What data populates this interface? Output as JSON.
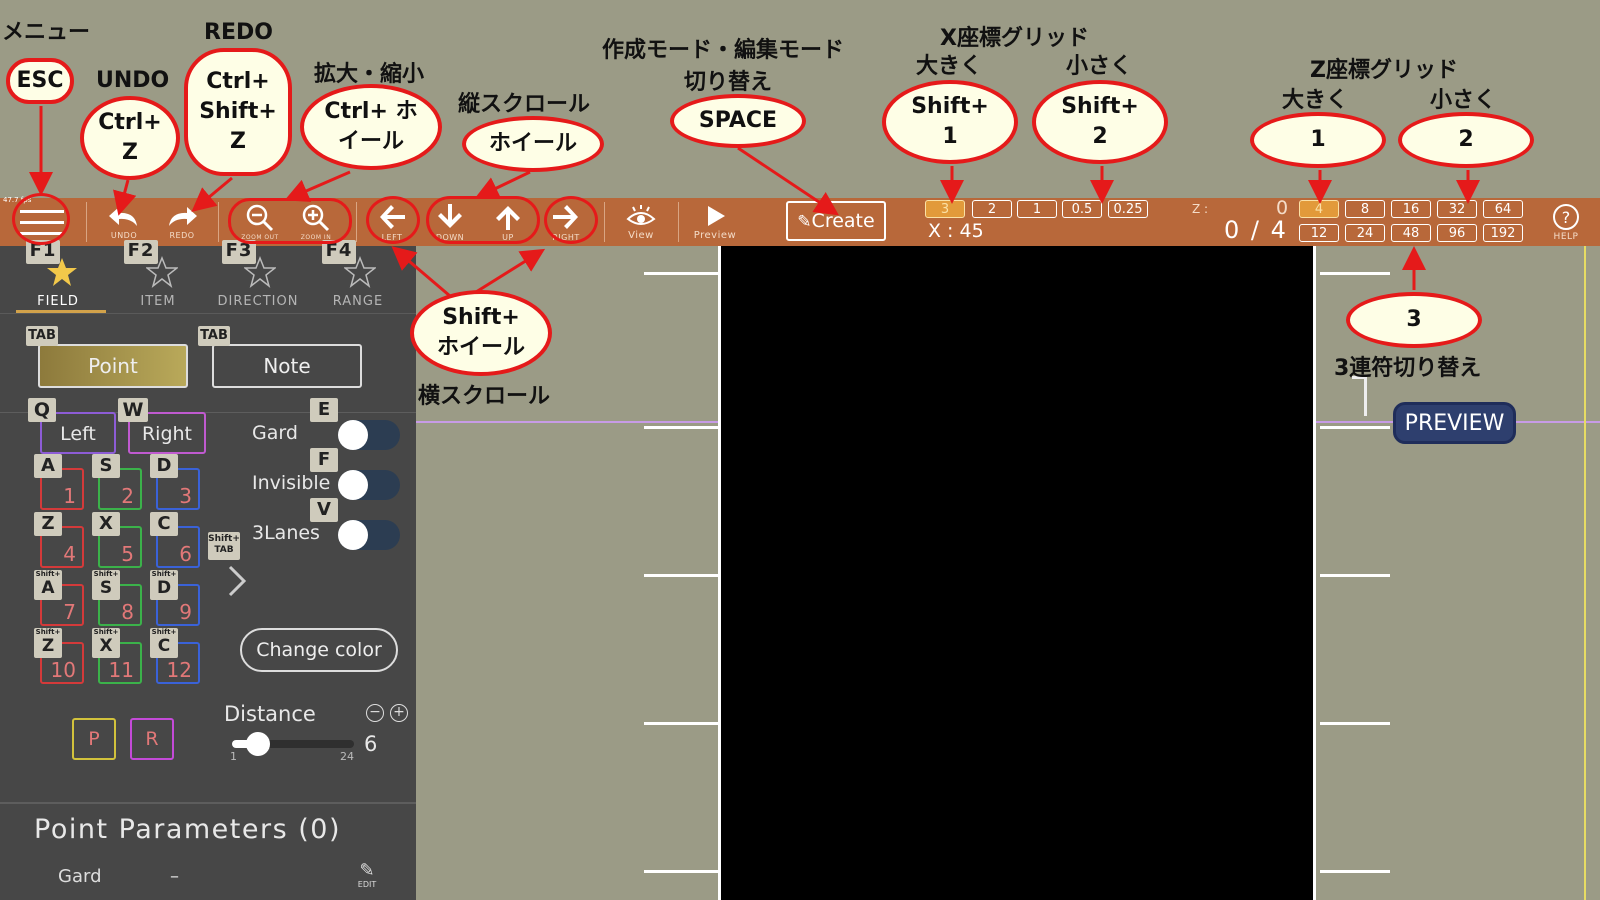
{
  "toolbar": {
    "fps": "47.7 fps",
    "undo": "UNDO",
    "redo": "REDO",
    "zoom_out": "ZOOM OUT",
    "zoom_in": "ZOOM IN",
    "left": "LEFT",
    "down": "DOWN",
    "up": "UP",
    "right": "RIGHT",
    "view": "View",
    "preview": "Preview",
    "create": "Create",
    "x_grid": [
      "3",
      "2",
      "1",
      "0.5",
      "0.25"
    ],
    "x_value": "X : 45",
    "z_label": "Z :",
    "z_value": "0",
    "z_fraction": "0 / 4",
    "z_grid_top": [
      "4",
      "8",
      "16",
      "32",
      "64"
    ],
    "z_grid_bottom": [
      "12",
      "24",
      "48",
      "96",
      "192"
    ],
    "help": "HELP"
  },
  "panel": {
    "tabs": [
      {
        "key": "F1",
        "label": "FIELD"
      },
      {
        "key": "F2",
        "label": "ITEM"
      },
      {
        "key": "F3",
        "label": "DIRECTION"
      },
      {
        "key": "F4",
        "label": "RANGE"
      }
    ],
    "tab_key": "TAB",
    "point": "Point",
    "note": "Note",
    "left": "Left",
    "right": "Right",
    "key_q": "Q",
    "key_w": "W",
    "keys": [
      {
        "key": "A",
        "num": "1"
      },
      {
        "key": "S",
        "num": "2"
      },
      {
        "key": "D",
        "num": "3"
      },
      {
        "key": "Z",
        "num": "4"
      },
      {
        "key": "X",
        "num": "5"
      },
      {
        "key": "C",
        "num": "6"
      },
      {
        "key": "A",
        "num": "7"
      },
      {
        "key": "S",
        "num": "8"
      },
      {
        "key": "D",
        "num": "9"
      },
      {
        "key": "Z",
        "num": "10"
      },
      {
        "key": "X",
        "num": "11"
      },
      {
        "key": "C",
        "num": "12"
      }
    ],
    "shift_tab": "Shift+ TAB",
    "gard": "Gard",
    "invisible": "Invisible",
    "three_lanes": "3Lanes",
    "key_e": "E",
    "key_f": "F",
    "key_v": "V",
    "change_color": "Change color",
    "distance": "Distance",
    "distance_min": "1",
    "distance_max": "24",
    "distance_value": "6",
    "p": "P",
    "r": "R",
    "params_title": "Point Parameters (0)",
    "param_gard": "Gard",
    "param_gard_val": "–",
    "edit": "EDIT"
  },
  "preview_btn": "PREVIEW",
  "annotations": {
    "menu": "メニュー",
    "esc": "ESC",
    "undo": "UNDO",
    "undo_key": "Ctrl+ Z",
    "redo": "REDO",
    "redo_key": "Ctrl+ Shift+ Z",
    "zoom": "拡大・縮小",
    "zoom_key": "Ctrl+ ホイール",
    "vscroll": "縦スクロール",
    "vscroll_key": "ホイール",
    "mode": "作成モード・編集モード",
    "mode2": "切り替え",
    "space": "SPACE",
    "xgrid": "X座標グリッド",
    "xbig": "大きく",
    "xsmall": "小さく",
    "x_key1": "Shift+ 1",
    "x_key2": "Shift+ 2",
    "zgrid": "Z座標グリッド",
    "zbig": "大きく",
    "zsmall": "小さく",
    "z_key1": "1",
    "z_key2": "2",
    "hscroll_key": "Shift+ ホイール",
    "hscroll": "横スクロール",
    "triplet_key": "3",
    "triplet": "3連符切り替え"
  }
}
